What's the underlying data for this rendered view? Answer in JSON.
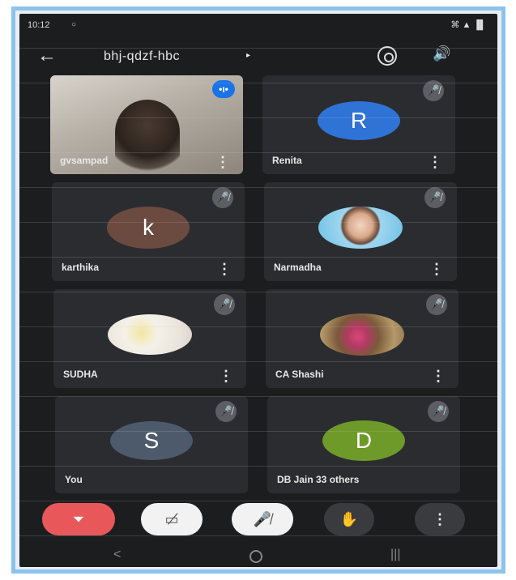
{
  "status_bar": {
    "time": "10:12",
    "indicator": "○",
    "icons": "⌘ ▲ ▐▌"
  },
  "header": {
    "back_icon": "←",
    "title": "bhj-qdzf-hbc",
    "caret": "▸",
    "switch_camera_icon": "switch-camera",
    "speaker_icon": "🔊"
  },
  "participants": [
    {
      "name": "gvsampad",
      "type": "video",
      "speaking_badge": "•ı•"
    },
    {
      "name": "Renita",
      "type": "initial",
      "initial": "R",
      "color": "#2f73d6"
    },
    {
      "name": "karthika",
      "type": "initial",
      "initial": "k",
      "color": "#6b4a40"
    },
    {
      "name": "Narmadha",
      "type": "photo"
    },
    {
      "name": "SUDHA",
      "type": "photo"
    },
    {
      "name": "CA Shashi",
      "type": "photo"
    },
    {
      "name": "You",
      "type": "initial",
      "initial": "S",
      "color": "#4d5a6b"
    },
    {
      "name": "DB Jain   33 others",
      "type": "initial",
      "initial": "D",
      "color": "#6e9a2a"
    }
  ],
  "tile_more_icon": "⋮",
  "tile_mute_icon": "🎤̸",
  "controls": {
    "end_call": "⏷",
    "camera_off": "▭̸",
    "mic_off": "🎤̸",
    "raise_hand": "✋",
    "more": "⋮"
  },
  "nav": {
    "back": "<",
    "recent": "|||"
  }
}
